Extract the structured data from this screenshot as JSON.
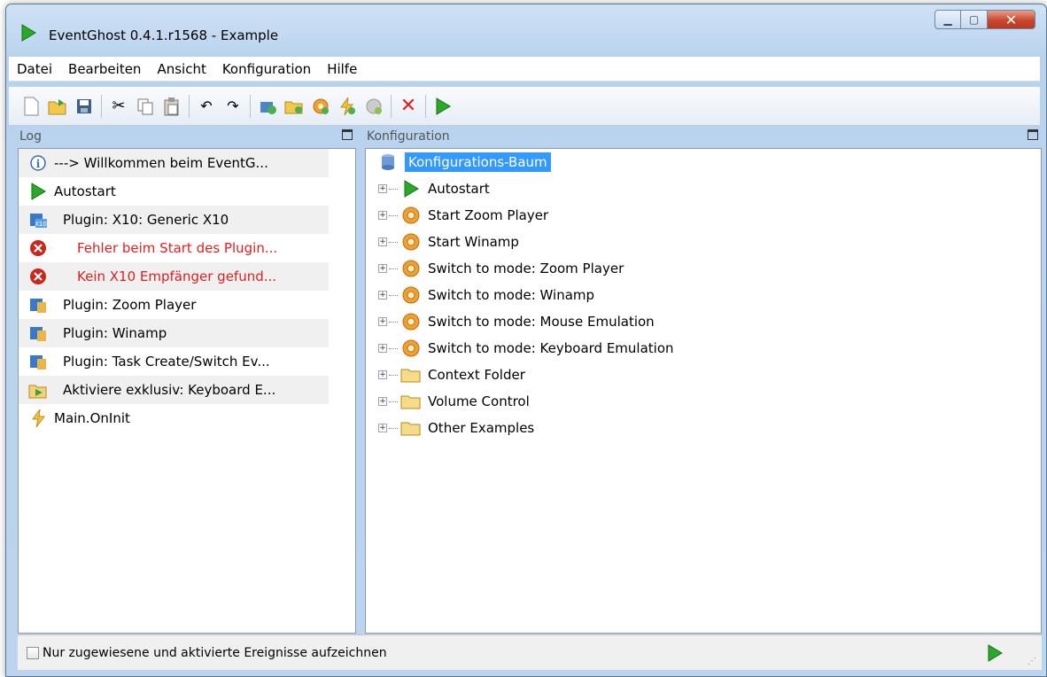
{
  "window": {
    "title": "EventGhost 0.4.1.r1568 - Example"
  },
  "menu": [
    "Datei",
    "Bearbeiten",
    "Ansicht",
    "Konfiguration",
    "Hilfe"
  ],
  "toolbar": {
    "icons": [
      "new-file-icon",
      "open-folder-icon",
      "save-icon",
      "cut-icon",
      "copy-icon",
      "paste-icon",
      "undo-icon",
      "redo-icon",
      "add-plugin-icon",
      "add-folder-icon",
      "add-macro-icon",
      "add-event-icon",
      "add-action-icon",
      "delete-icon",
      "execute-icon"
    ]
  },
  "log": {
    "header": "Log",
    "rows": [
      {
        "text": "---> Willkommen beim EventG...",
        "icon": "info-icon",
        "style": "normal"
      },
      {
        "text": "Autostart",
        "icon": "play-icon",
        "style": "normal"
      },
      {
        "text": "Plugin: X10: Generic X10",
        "icon": "x10-plugin-icon",
        "style": "indent"
      },
      {
        "text": "Fehler beim Start des Plugin...",
        "icon": "error-icon",
        "style": "error"
      },
      {
        "text": "Kein X10 Empfänger gefund...",
        "icon": "error-icon",
        "style": "error"
      },
      {
        "text": "Plugin: Zoom Player",
        "icon": "plugin-icon",
        "style": "indent"
      },
      {
        "text": "Plugin: Winamp",
        "icon": "plugin-icon",
        "style": "indent"
      },
      {
        "text": "Plugin: Task Create/Switch Ev...",
        "icon": "plugin-icon",
        "style": "indent"
      },
      {
        "text": "Aktiviere exklusiv: Keyboard E...",
        "icon": "folder-action-icon",
        "style": "indent"
      },
      {
        "text": "Main.OnInit",
        "icon": "event-lightning-icon",
        "style": "normal"
      }
    ]
  },
  "config": {
    "header": "Konfiguration",
    "root": "Konfigurations-Baum",
    "items": [
      {
        "label": "Autostart",
        "icon": "play-icon"
      },
      {
        "label": "Start Zoom Player",
        "icon": "macro-icon"
      },
      {
        "label": "Start Winamp",
        "icon": "macro-icon"
      },
      {
        "label": "Switch to mode: Zoom Player",
        "icon": "macro-icon"
      },
      {
        "label": "Switch to mode: Winamp",
        "icon": "macro-icon"
      },
      {
        "label": "Switch to mode: Mouse Emulation",
        "icon": "macro-icon"
      },
      {
        "label": "Switch to mode: Keyboard Emulation",
        "icon": "macro-icon"
      },
      {
        "label": "Context Folder",
        "icon": "folder-icon"
      },
      {
        "label": "Volume Control",
        "icon": "folder-icon"
      },
      {
        "label": "Other Examples",
        "icon": "folder-icon"
      }
    ]
  },
  "status": {
    "checkbox_label": "Nur zugewiesene und aktivierte Ereignisse aufzeichnen",
    "checked": false
  }
}
